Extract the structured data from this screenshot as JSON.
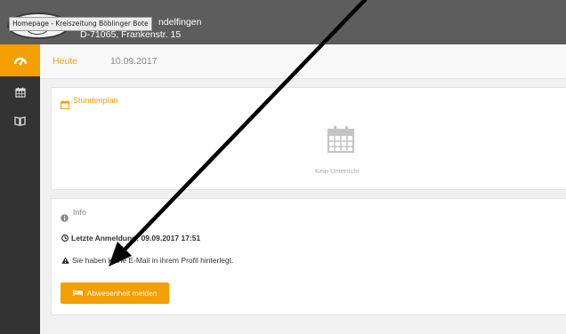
{
  "header": {
    "tooltip": "Homepage - Kreiszeitung Böblinger Bote",
    "school_name": "ndelfingen",
    "school_address": "D-71065, Frankenstr. 15"
  },
  "sidebar": {
    "items": [
      {
        "icon": "dashboard-icon",
        "active": true
      },
      {
        "icon": "calendar-icon",
        "active": false
      },
      {
        "icon": "book-icon",
        "active": false
      }
    ]
  },
  "breadcrumb": {
    "today": "Heute",
    "date": "10.09.2017"
  },
  "timetable": {
    "title": "Stundenplan",
    "empty_text": "Kein Unterricht"
  },
  "info": {
    "title": "Info",
    "last_login_prefix": "Letzte Anmeldung:",
    "last_login_value": "09.09.2017 17:51",
    "email_warning": "Sie haben keine E-Mail in ihrem Profil hinterlegt.",
    "report_absence_label": "Abwesenheit melden"
  },
  "colors": {
    "accent": "#f59e00",
    "sidebar": "#333333",
    "header": "#5d5d5d"
  }
}
